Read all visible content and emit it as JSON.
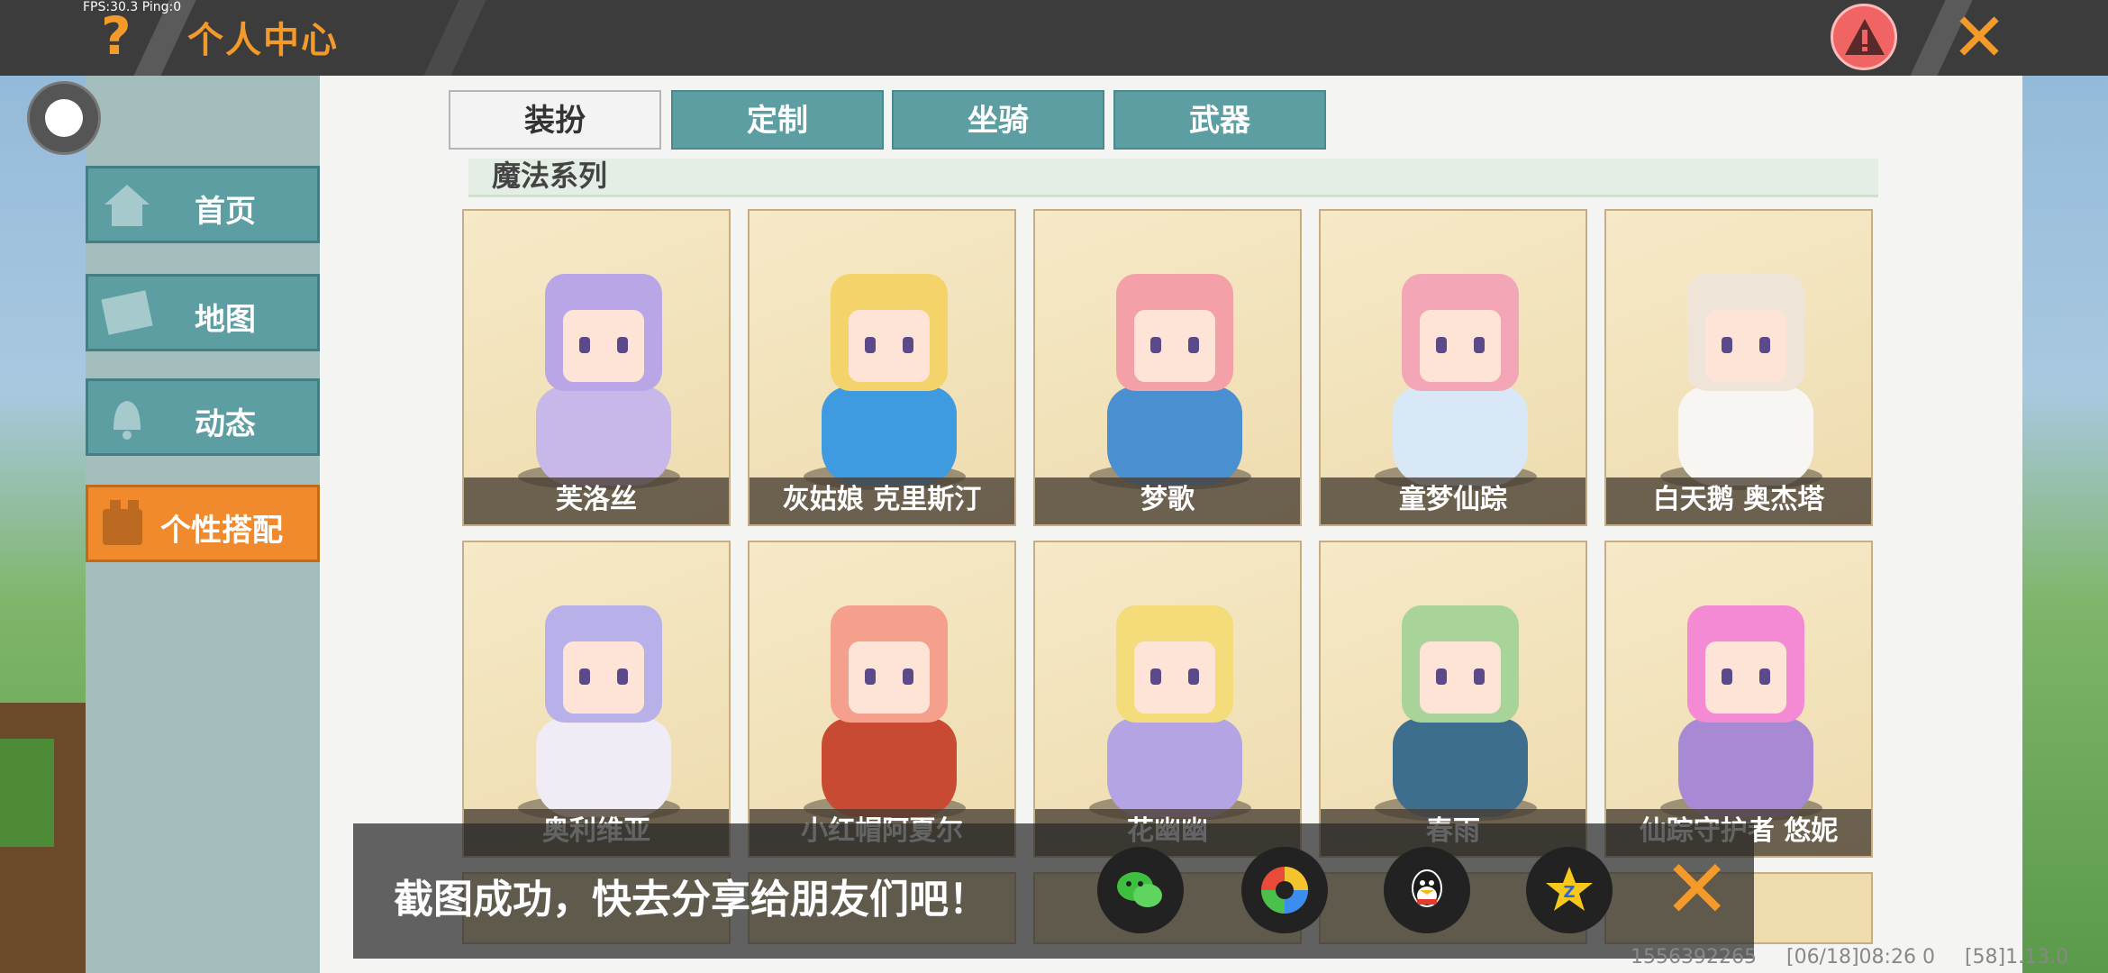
{
  "hud": {
    "fps": "FPS:30.3  Ping:0"
  },
  "header": {
    "help_icon": "?",
    "title": "个人中心",
    "close_icon": "✕"
  },
  "sidebar": {
    "items": [
      {
        "label": "首页",
        "icon": "home-icon"
      },
      {
        "label": "地图",
        "icon": "map-icon"
      },
      {
        "label": "动态",
        "icon": "bell-icon"
      },
      {
        "label": "个性搭配",
        "icon": "outfit-icon",
        "active": true
      }
    ]
  },
  "tabs": [
    {
      "label": "装扮",
      "selected": true
    },
    {
      "label": "定制"
    },
    {
      "label": "坐骑"
    },
    {
      "label": "武器"
    }
  ],
  "series_title": "魔法系列",
  "cards": [
    {
      "name": "芙洛丝",
      "hair": "#b9a6e6",
      "dress": "#c8b8ea"
    },
    {
      "name": "灰姑娘 克里斯汀",
      "hair": "#f4d46a",
      "dress": "#3f9be0"
    },
    {
      "name": "梦歌",
      "hair": "#f4a0a8",
      "dress": "#4a8fcf"
    },
    {
      "name": "童梦仙踪",
      "hair": "#f2a6b6",
      "dress": "#d8e8f6"
    },
    {
      "name": "白天鹅 奥杰塔",
      "hair": "#efe4d8",
      "dress": "#f8f6f2"
    },
    {
      "name": "奥利维亚",
      "hair": "#b8b0e8",
      "dress": "#f0ecf6"
    },
    {
      "name": "小红帽阿夏尔",
      "hair": "#f4a08c",
      "dress": "#c84a32"
    },
    {
      "name": "花幽幽",
      "hair": "#f4dc7a",
      "dress": "#b4a4e4"
    },
    {
      "name": "春雨",
      "hair": "#a8d49a",
      "dress": "#3e6e8e"
    },
    {
      "name": "仙踪守护者 悠妮",
      "hair": "#f48ad4",
      "dress": "#a88ad4"
    }
  ],
  "toast": {
    "message": "截图成功，快去分享给朋友们吧！"
  },
  "share_targets": [
    "wechat-icon",
    "moments-icon",
    "qq-icon",
    "qzone-icon"
  ],
  "footer": {
    "uid": "1556392265",
    "datetime": "[06/18]08:26 0",
    "version": "[58]1.13.0"
  },
  "colors": {
    "accent": "#f39a2a",
    "tab": "#5d9ea2",
    "panel": "#f4f4f2"
  }
}
